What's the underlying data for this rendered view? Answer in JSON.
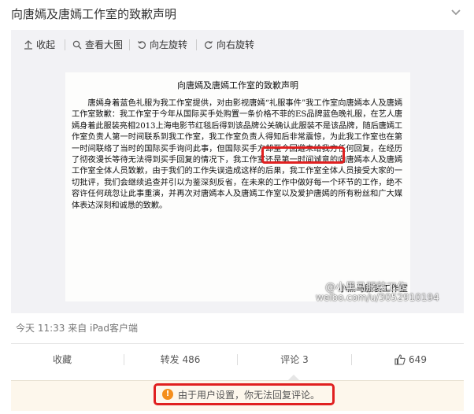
{
  "post": {
    "title": "向唐嫣及唐嫣工作室的致歉声明"
  },
  "toolbar": {
    "collapse": "收起",
    "view_large": "查看大图",
    "rotate_left": "向左旋转",
    "rotate_right": "向右旋转"
  },
  "document": {
    "title": "向唐嫣及唐嫣工作室的致歉声明",
    "body": "唐嫣身着蓝色礼服为我工作室提供，对由影视唐嫣“礼服事件”我工作室向唐嫣本人及唐嫣工作室致歉：我工作室于今年从国际买手处购置一条价格不菲的ES品牌蓝色晚礼服，在艺人唐嫣身着此服装亮相2013上海电影节红毯后得到该品牌公关确认此服装不是该品牌，随后唐嫣工作室负责人第一时间联系到我工作室，我工作室负责人得知后非常震惊，为此我工作室也在第一时间联络了当时的国际买手询问此事，但国际买手方却至今回避未给我方任何回复，在经历了彻夜漫长等待无法得到买手回复的情况下，我工作室还是第一时间诚意的向唐嫣本人及唐嫣工作室全体人员致歉，由于我们的工作失误造成这样的后果，我工作室全体人员接受大家的一切批评，我们会继续追查并引以为鉴深刻反省，在未来的工作中做好每一个环节的工作，绝不容许任何疏忽让此事重演，并再次对唐嫣本人及唐嫣工作室以及爱护唐嫣的所有粉丝和广大媒体表达深刻和诚恳的致歉。",
    "highlight": "从国际买手处购置",
    "signature": "小黑马服装工作室",
    "watermark_name": "@小黑马服装工作",
    "watermark_url": "weibo.com/u/3052910194"
  },
  "meta": {
    "time_source": "今天 11:33 来自 iPad客户端"
  },
  "actions": {
    "favorite": "收藏",
    "repost": "转发 486",
    "comment": "评论 3",
    "like": "649"
  },
  "notice": {
    "text": "由于用户设置，你无法回复评论。"
  },
  "colors": {
    "highlight_border": "#e02020",
    "warning": "#f48e1c",
    "notice_bg": "#fdf7ec"
  }
}
